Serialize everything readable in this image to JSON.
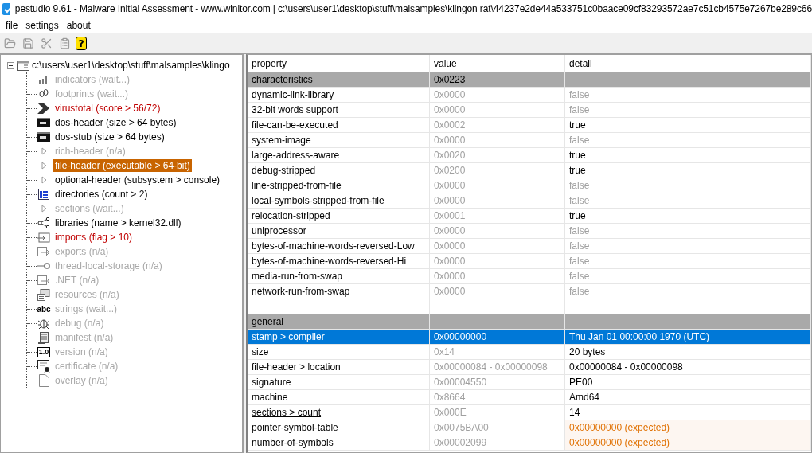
{
  "window": {
    "title": "pestudio 9.61 - Malware Initial Assessment - www.winitor.com | c:\\users\\user1\\desktop\\stuff\\malsamples\\klingon rat\\44237e2de44a533751c0baace09cf83293572ae7c51cb4575e7267be289c66"
  },
  "menu": [
    "file",
    "settings",
    "about"
  ],
  "toolbar": [
    {
      "kind": "open",
      "disabled": true
    },
    {
      "kind": "save",
      "disabled": true
    },
    {
      "kind": "cut",
      "disabled": true
    },
    {
      "kind": "clipboard",
      "disabled": true
    },
    {
      "kind": "help",
      "label": "?",
      "disabled": false
    }
  ],
  "tree": {
    "label": "c:\\users\\user1\\desktop\\stuff\\malsamples\\klingo",
    "expanded": true,
    "children": [
      {
        "kind": "bars",
        "label": "indicators (wait...)",
        "disabled": true,
        "flagged": false,
        "selected": false
      },
      {
        "kind": "footprints",
        "label": "footprints (wait...)",
        "disabled": true,
        "flagged": false,
        "selected": false
      },
      {
        "kind": "arrow",
        "label": "virustotal (score > 56/72)",
        "disabled": false,
        "flagged": true,
        "selected": false
      },
      {
        "kind": "console",
        "label": "dos-header (size > 64 bytes)",
        "disabled": false,
        "flagged": false,
        "selected": false
      },
      {
        "kind": "console",
        "label": "dos-stub (size > 64 bytes)",
        "disabled": false,
        "flagged": false,
        "selected": false
      },
      {
        "kind": "chevron",
        "label": "rich-header (n/a)",
        "disabled": true,
        "flagged": false,
        "selected": false
      },
      {
        "kind": "chevron",
        "label": "file-header (executable > 64-bit)",
        "disabled": false,
        "flagged": false,
        "selected": true
      },
      {
        "kind": "chevron",
        "label": "optional-header (subsystem > console)",
        "disabled": false,
        "flagged": false,
        "selected": false
      },
      {
        "kind": "grid",
        "label": "directories (count > 2)",
        "disabled": false,
        "flagged": false,
        "selected": false
      },
      {
        "kind": "chevron",
        "label": "sections (wait...)",
        "disabled": true,
        "flagged": false,
        "selected": false
      },
      {
        "kind": "share",
        "label": "libraries (name > kernel32.dll)",
        "disabled": false,
        "flagged": false,
        "selected": false
      },
      {
        "kind": "import",
        "label": "imports (flag > 10)",
        "disabled": false,
        "flagged": true,
        "selected": false
      },
      {
        "kind": "export",
        "label": "exports (n/a)",
        "disabled": true,
        "flagged": false,
        "selected": false
      },
      {
        "kind": "key",
        "label": "thread-local-storage (n/a)",
        "disabled": true,
        "flagged": false,
        "selected": false
      },
      {
        "kind": "export",
        "label": ".NET (n/a)",
        "disabled": true,
        "flagged": false,
        "selected": false
      },
      {
        "kind": "resources",
        "label": "resources (n/a)",
        "disabled": true,
        "flagged": false,
        "selected": false
      },
      {
        "kind": "text",
        "icon_text": "abc",
        "label": "strings (wait...)",
        "disabled": true,
        "flagged": false,
        "selected": false
      },
      {
        "kind": "bug",
        "label": "debug (n/a)",
        "disabled": true,
        "flagged": false,
        "selected": false
      },
      {
        "kind": "manifest",
        "label": "manifest (n/a)",
        "disabled": true,
        "flagged": false,
        "selected": false
      },
      {
        "kind": "boxed-text",
        "icon_text": "1.0",
        "label": "version (n/a)",
        "disabled": true,
        "flagged": false,
        "selected": false
      },
      {
        "kind": "certificate",
        "label": "certificate (n/a)",
        "disabled": true,
        "flagged": false,
        "selected": false
      },
      {
        "kind": "page",
        "label": "overlay (n/a)",
        "disabled": true,
        "flagged": false,
        "selected": false
      }
    ]
  },
  "table": {
    "columns": [
      "property",
      "value",
      "detail"
    ],
    "rows": [
      {
        "kind": "section",
        "property": "characteristics",
        "value": "0x0223",
        "selected": false
      },
      {
        "kind": "row",
        "property": "dynamic-link-library",
        "value": "0x0000",
        "detail": "false",
        "muted": true,
        "warning": false,
        "selected": false
      },
      {
        "kind": "row",
        "property": "32-bit words support",
        "value": "0x0000",
        "detail": "false",
        "muted": true,
        "warning": false,
        "selected": false
      },
      {
        "kind": "row",
        "property": "file-can-be-executed",
        "value": "0x0002",
        "detail": "true",
        "muted": false,
        "warning": false,
        "selected": false
      },
      {
        "kind": "row",
        "property": "system-image",
        "value": "0x0000",
        "detail": "false",
        "muted": true,
        "warning": false,
        "selected": false
      },
      {
        "kind": "row",
        "property": "large-address-aware",
        "value": "0x0020",
        "detail": "true",
        "muted": false,
        "warning": false,
        "selected": false
      },
      {
        "kind": "row",
        "property": "debug-stripped",
        "value": "0x0200",
        "detail": "true",
        "muted": false,
        "warning": false,
        "selected": false
      },
      {
        "kind": "row",
        "property": "line-stripped-from-file",
        "value": "0x0000",
        "detail": "false",
        "muted": true,
        "warning": false,
        "selected": false
      },
      {
        "kind": "row",
        "property": "local-symbols-stripped-from-file",
        "value": "0x0000",
        "detail": "false",
        "muted": true,
        "warning": false,
        "selected": false
      },
      {
        "kind": "row",
        "property": "relocation-stripped",
        "value": "0x0001",
        "detail": "true",
        "muted": false,
        "warning": false,
        "selected": false
      },
      {
        "kind": "row",
        "property": "uniprocessor",
        "value": "0x0000",
        "detail": "false",
        "muted": true,
        "warning": false,
        "selected": false
      },
      {
        "kind": "row",
        "property": "bytes-of-machine-words-reversed-Low",
        "value": "0x0000",
        "detail": "false",
        "muted": true,
        "warning": false,
        "selected": false
      },
      {
        "kind": "row",
        "property": "bytes-of-machine-words-reversed-Hi",
        "value": "0x0000",
        "detail": "false",
        "muted": true,
        "warning": false,
        "selected": false
      },
      {
        "kind": "row",
        "property": "media-run-from-swap",
        "value": "0x0000",
        "detail": "false",
        "muted": true,
        "warning": false,
        "selected": false
      },
      {
        "kind": "row",
        "property": "network-run-from-swap",
        "value": "0x0000",
        "detail": "false",
        "muted": true,
        "warning": false,
        "selected": false
      },
      {
        "kind": "section",
        "property": "general",
        "selected": false
      },
      {
        "kind": "row",
        "property": "stamp > compiler",
        "value": "0x00000000",
        "detail": "Thu Jan 01 00:00:00 1970 (UTC)",
        "muted": false,
        "warning": false,
        "selected": true
      },
      {
        "kind": "row",
        "property": "size",
        "value": "0x14",
        "detail": "20 bytes",
        "muted": false,
        "warning": false,
        "selected": false
      },
      {
        "kind": "row",
        "property": "file-header > location",
        "value": "0x00000084 - 0x00000098",
        "detail": "0x00000084 - 0x00000098",
        "muted": false,
        "warning": false,
        "selected": false
      },
      {
        "kind": "row",
        "property": "signature",
        "value": "0x00004550",
        "detail": "PE00",
        "muted": false,
        "warning": false,
        "selected": false
      },
      {
        "kind": "row",
        "property": "machine",
        "value": "0x8664",
        "detail": "Amd64",
        "muted": false,
        "warning": false,
        "selected": false
      },
      {
        "kind": "link-row",
        "property": "sections > count",
        "value": "0x000E",
        "detail": "14",
        "muted": false,
        "warning": false,
        "selected": false
      },
      {
        "kind": "row",
        "property": "pointer-symbol-table",
        "value": "0x0075BA00",
        "detail": "0x00000000 (expected)",
        "muted": false,
        "warning": true,
        "selected": false
      },
      {
        "kind": "row",
        "property": "number-of-symbols",
        "value": "0x00002099",
        "detail": "0x00000000 (expected)",
        "muted": false,
        "warning": true,
        "selected": false
      }
    ]
  }
}
